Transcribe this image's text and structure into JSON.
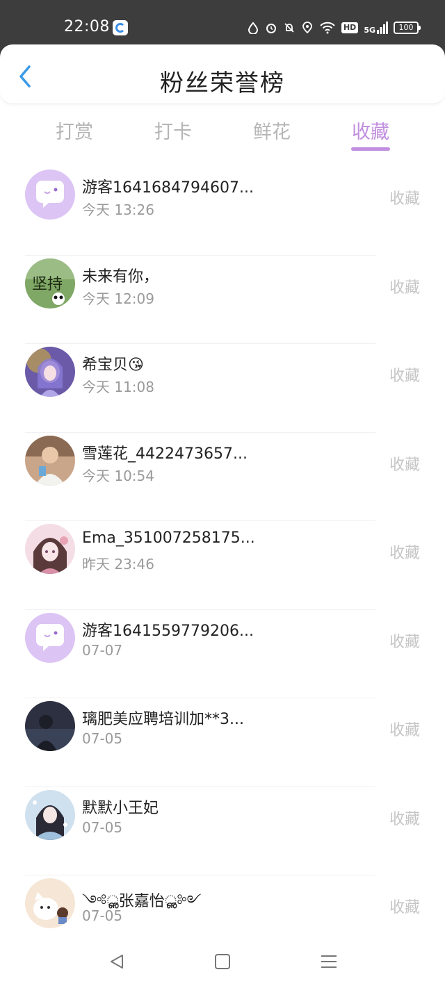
{
  "status_bar": {
    "time": "22:08",
    "icons": [
      "drop-icon",
      "alarm-icon",
      "mute-bell-icon",
      "location-icon",
      "wifi-icon"
    ],
    "hd": "HD",
    "network": "5G",
    "battery": "100"
  },
  "header": {
    "title": "粉丝荣誉榜"
  },
  "tabs": [
    {
      "label": "打赏",
      "active": false
    },
    {
      "label": "打卡",
      "active": false
    },
    {
      "label": "鲜花",
      "active": false
    },
    {
      "label": "收藏",
      "active": true
    }
  ],
  "colors": {
    "accent": "#c18ee0",
    "back_arrow": "#3a9ae6",
    "muted": "#b5b5b5"
  },
  "list": [
    {
      "name": "游客1641684794607...",
      "time": "今天 13:26",
      "action": "收藏",
      "avatar": "guest-chat-avatar"
    },
    {
      "name": "未来有你，",
      "time": "今天 12:09",
      "action": "收藏",
      "avatar": "panda-avatar"
    },
    {
      "name": "希宝贝😘",
      "time": "今天 11:08",
      "action": "收藏",
      "avatar": "anime-girl-avatar"
    },
    {
      "name": "雪莲花_4422473657...",
      "time": "今天 10:54",
      "action": "收藏",
      "avatar": "photo-avatar"
    },
    {
      "name": "Ema_351007258175...",
      "time": "昨天 23:46",
      "action": "收藏",
      "avatar": "anime-pink-avatar"
    },
    {
      "name": "游客1641559779206...",
      "time": "07-07",
      "action": "收藏",
      "avatar": "guest-chat-avatar"
    },
    {
      "name": "璃肥美应聘培训加**3...",
      "time": "07-05",
      "action": "收藏",
      "avatar": "dark-photo-avatar"
    },
    {
      "name": "默默小王妃",
      "time": "07-05",
      "action": "收藏",
      "avatar": "anime-blue-avatar"
    },
    {
      "name": "༺ൢ张嘉怡ൢ༻",
      "time": "07-05",
      "action": "收藏",
      "avatar": "cartoon-cat-avatar"
    }
  ]
}
